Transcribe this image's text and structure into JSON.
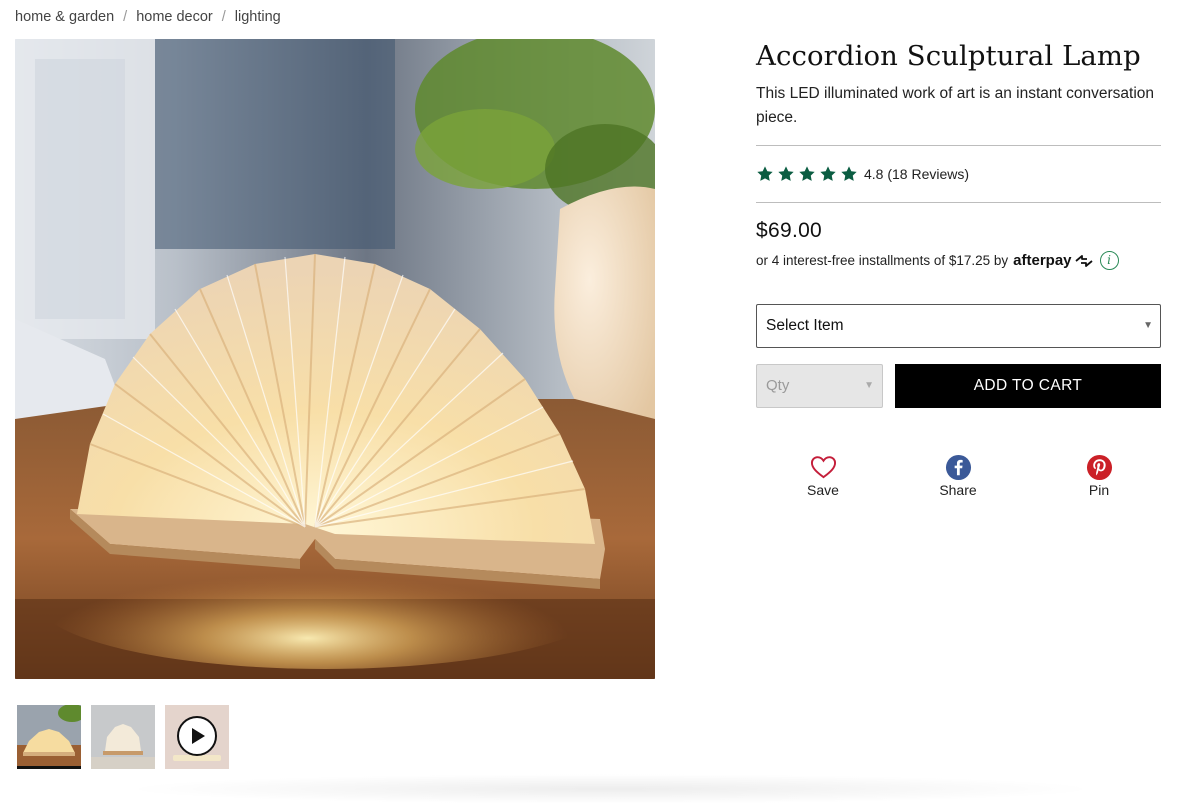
{
  "breadcrumb": {
    "items": [
      "home & garden",
      "home decor",
      "lighting"
    ],
    "separator": "/"
  },
  "product": {
    "title": "Accordion Sculptural Lamp",
    "subtitle": "This LED illuminated work of art is an instant conversation piece.",
    "rating": {
      "stars": 5,
      "star_color": "#0b5d42",
      "text": "4.8 (18 Reviews)"
    },
    "price": "$69.00",
    "installments": {
      "text": "or 4 interest-free installments of $17.25 by",
      "provider": "afterpay",
      "info_icon": "info-icon"
    }
  },
  "form": {
    "select_item": "Select Item",
    "qty_placeholder": "Qty",
    "add_to_cart": "ADD TO CART"
  },
  "social": {
    "save": "Save",
    "share": "Share",
    "pin": "Pin"
  },
  "gallery": {
    "thumbnails": [
      "lamp-on-desk",
      "lamp-side-view",
      "video"
    ],
    "active_index": 0
  },
  "colors": {
    "accent_green": "#0b5d42",
    "button_black": "#000000",
    "heart_red": "#c41e3a",
    "facebook_blue": "#3b5998",
    "pinterest_red": "#cb2027"
  }
}
